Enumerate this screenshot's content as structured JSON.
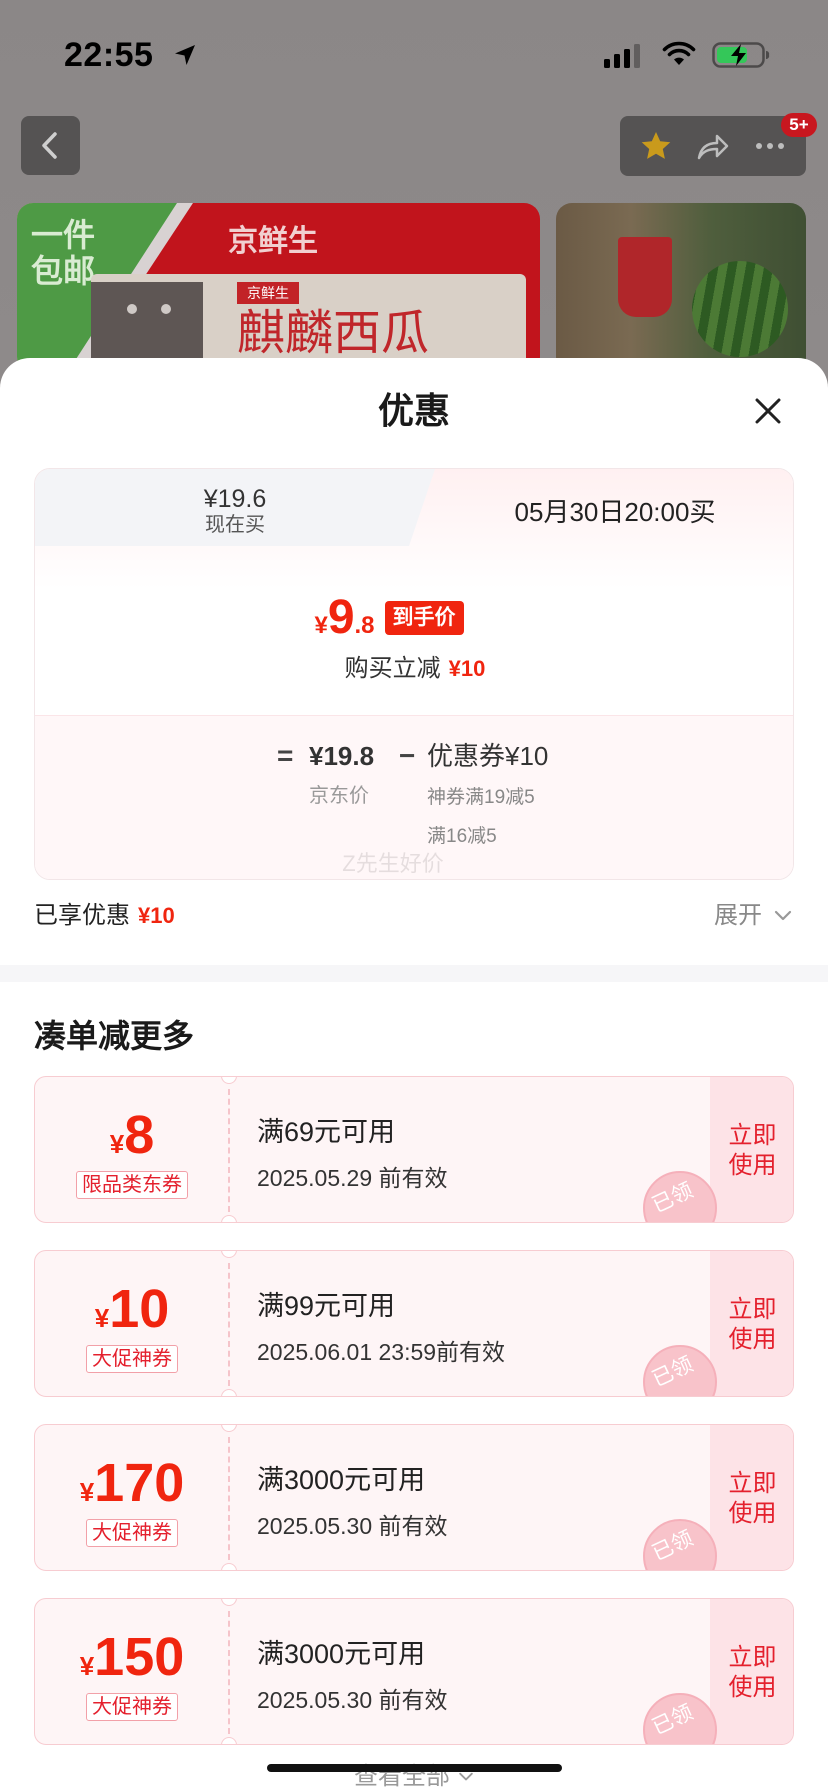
{
  "status_bar": {
    "time": "22:55"
  },
  "header": {
    "badge": "5+"
  },
  "banner": {
    "corner_line1": "一件",
    "corner_line2": "包邮",
    "brand": "京鲜生",
    "box_brand": "京鲜生",
    "product_title": "麒麟西瓜"
  },
  "sheet": {
    "title": "优惠",
    "tab_now": {
      "price": "¥19.6",
      "label": "现在买"
    },
    "tab_later": {
      "label": "05月30日20:00买"
    },
    "final_price": {
      "currency": "¥",
      "integer": "9",
      "decimal": ".8",
      "badge": "到手价"
    },
    "reduction": {
      "label": "购买立减",
      "amount": "¥10"
    },
    "formula": {
      "equals": "=",
      "jd_price": "¥19.8",
      "minus": "−",
      "coupon": "优惠券¥10",
      "jd_price_label": "京东价",
      "coupon_detail_1": "神券满19减5",
      "coupon_detail_2": "满16减5"
    },
    "watermark": "Z先生好价",
    "enjoyed": {
      "label": "已享优惠",
      "amount": "¥10",
      "expand": "展开"
    }
  },
  "more": {
    "title": "凑单减更多",
    "coupons": [
      {
        "currency": "¥",
        "amount": "8",
        "tag": "限品类东券",
        "condition": "满69元可用",
        "validity": "2025.05.29 前有效",
        "action_line1": "立即",
        "action_line2": "使用",
        "stamp": "已领"
      },
      {
        "currency": "¥",
        "amount": "10",
        "tag": "大促神券",
        "condition": "满99元可用",
        "validity": "2025.06.01 23:59前有效",
        "action_line1": "立即",
        "action_line2": "使用",
        "stamp": "已领"
      },
      {
        "currency": "¥",
        "amount": "170",
        "tag": "大促神券",
        "condition": "满3000元可用",
        "validity": "2025.05.30 前有效",
        "action_line1": "立即",
        "action_line2": "使用",
        "stamp": "已领"
      },
      {
        "currency": "¥",
        "amount": "150",
        "tag": "大促神券",
        "condition": "满3000元可用",
        "validity": "2025.05.30 前有效",
        "action_line1": "立即",
        "action_line2": "使用",
        "stamp": "已领"
      }
    ],
    "view_all": "查看全部"
  },
  "icons": [
    "location-icon",
    "signal-icon",
    "wifi-icon",
    "battery-icon",
    "back-icon",
    "star-icon",
    "share-icon",
    "more-icon",
    "close-icon",
    "chevron-down-icon"
  ],
  "colors": {
    "accent_red": "#f0250f",
    "coupon_bg": "#fef5f6",
    "coupon_border": "#f7ccd1",
    "badge_red": "#c8171f"
  }
}
